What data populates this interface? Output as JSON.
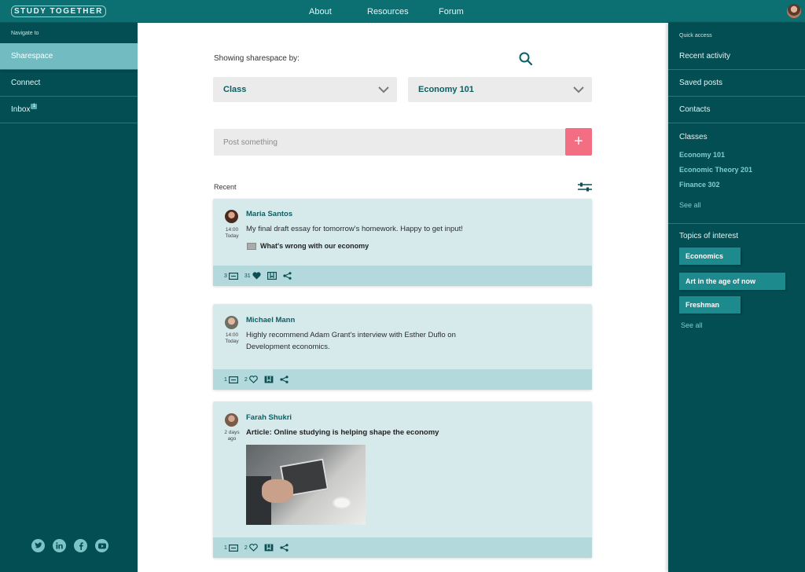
{
  "app": {
    "logo_text": "STUDY TOGETHER"
  },
  "topnav": {
    "about": "About",
    "resources": "Resources",
    "forum": "Forum"
  },
  "left_sidebar": {
    "label": "Navigate to",
    "items": [
      {
        "label": "Sharespace"
      },
      {
        "label": "Connect"
      },
      {
        "label": "Inbox",
        "badge": "1"
      }
    ]
  },
  "right_sidebar": {
    "label": "Quick access",
    "items": [
      {
        "label": "Recent activity"
      },
      {
        "label": "Saved posts"
      },
      {
        "label": "Contacts"
      }
    ],
    "classes_heading": "Classes",
    "classes": [
      "Economy 101",
      "Economic Theory 201",
      "Finance 302"
    ],
    "classes_see_all": "See all",
    "topics_heading": "Topics of interest",
    "topics": [
      "Economics",
      "Art in the age of now",
      "Freshman"
    ],
    "topics_see_all": "See all"
  },
  "main": {
    "showing_label": "Showing sharespace by:",
    "filter_type": "Class",
    "filter_value": "Economy 101",
    "post_placeholder": "Post something",
    "post_add": "+",
    "recent_label": "Recent"
  },
  "posts": [
    {
      "author": "Maria Santos",
      "time": "14:00",
      "date": "Today",
      "text": "My final draft essay for tomorrow's homework. Happy to get input!",
      "attachment": "What's wrong with our economy",
      "comments": "3",
      "likes": "31"
    },
    {
      "author": "Michael Mann",
      "time": "14:00",
      "date": "Today",
      "text_line1": "Highly recommend Adam Grant's interview with Esther Duflo on",
      "text_line2": "Development economics.",
      "comments": "1",
      "likes": "2"
    },
    {
      "author": "Farah Shukri",
      "time": "2 days",
      "date": "ago",
      "article": "Article: Online studying is helping shape the economy",
      "comments": "1",
      "likes": "2"
    }
  ],
  "socials": [
    "twitter-icon",
    "linkedin-icon",
    "facebook-icon",
    "youtube-icon"
  ],
  "colors": {
    "topbar": "#0c6f72",
    "sidebar": "#024e52",
    "accent": "#f36d83",
    "card": "#d6eaec",
    "active": "#72bcc1"
  }
}
